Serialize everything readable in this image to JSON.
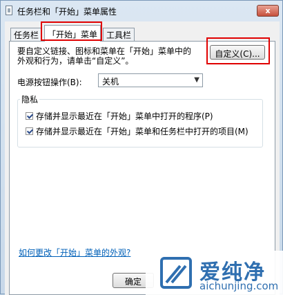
{
  "window": {
    "title": "任务栏和「开始」菜单属性",
    "close_label": "x"
  },
  "tabs": [
    {
      "label": "任务栏",
      "active": false
    },
    {
      "label": "「开始」菜单",
      "active": true
    },
    {
      "label": "工具栏",
      "active": false
    }
  ],
  "start_menu": {
    "description_line1": "要自定义链接、图标和菜单在「开始」菜单中的",
    "description_line2": "外观和行为，请单击“自定义”。",
    "customize_button": "自定义(C)...",
    "power_label": "电源按钮操作(B):",
    "power_value": "关机",
    "privacy_title": "隐私",
    "privacy_items": [
      {
        "label": "存储并显示最近在「开始」菜单中打开的程序(P)",
        "checked": true
      },
      {
        "label": "存储并显示最近在「开始」菜单和任务栏中打开的项目(M)",
        "checked": true
      }
    ],
    "help_link": "如何更改「开始」菜单的外观?"
  },
  "footer": {
    "ok_button": "确定"
  },
  "watermark": {
    "cn_text": "爱纯净",
    "en_text": "aichunjing.com"
  },
  "annotation_color": "#e00000"
}
